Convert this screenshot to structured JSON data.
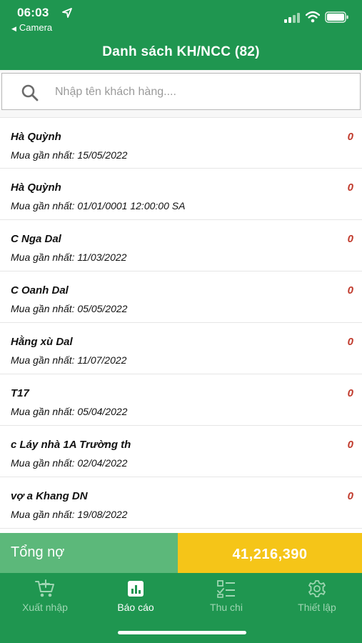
{
  "status_bar": {
    "time": "06:03",
    "back_app": "Camera"
  },
  "header": {
    "title": "Danh sách KH/NCC (82)"
  },
  "search": {
    "placeholder": "Nhập tên khách hàng....",
    "value": ""
  },
  "customers": [
    {
      "name": "Hà Quỳnh",
      "last_purchase": "Mua gần nhất: 15/05/2022",
      "debt": "0"
    },
    {
      "name": "Hà Quỳnh",
      "last_purchase": "Mua gần nhất: 01/01/0001 12:00:00 SA",
      "debt": "0"
    },
    {
      "name": "C Nga Dal",
      "last_purchase": "Mua gần nhất: 11/03/2022",
      "debt": "0"
    },
    {
      "name": "C Oanh Dal",
      "last_purchase": "Mua gần nhất: 05/05/2022",
      "debt": "0"
    },
    {
      "name": "Hằng xù Dal",
      "last_purchase": "Mua gần nhất: 11/07/2022",
      "debt": "0"
    },
    {
      "name": "T17",
      "last_purchase": "Mua gần nhất: 05/04/2022",
      "debt": "0"
    },
    {
      "name": "c Láy nhà 1A Trường th",
      "last_purchase": "Mua gần nhất: 02/04/2022",
      "debt": "0"
    },
    {
      "name": "vợ a Khang DN",
      "last_purchase": "Mua gần nhất: 19/08/2022",
      "debt": "0"
    }
  ],
  "total": {
    "label": "Tổng nợ",
    "value": "41,216,390"
  },
  "tabs": [
    {
      "label": "Xuất nhập",
      "icon": "cart-icon",
      "active": false
    },
    {
      "label": "Báo cáo",
      "icon": "bar-chart-icon",
      "active": true
    },
    {
      "label": "Thu chi",
      "icon": "checklist-icon",
      "active": false
    },
    {
      "label": "Thiết lập",
      "icon": "gear-icon",
      "active": false
    }
  ],
  "colors": {
    "brand_green": "#1f9650",
    "total_label_bg": "#5cb87a",
    "total_value_bg": "#f5c518",
    "debt_red": "#c0392b"
  }
}
